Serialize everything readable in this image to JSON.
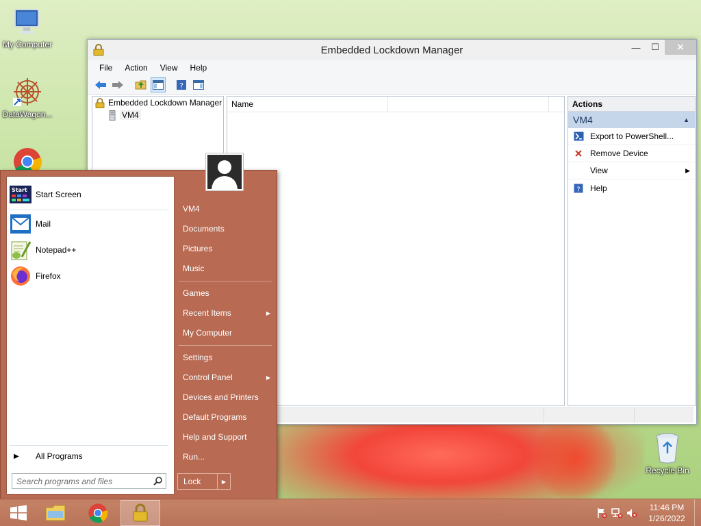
{
  "desktop": {
    "icons": [
      {
        "label": "My Computer"
      },
      {
        "label": "DataWagon..."
      },
      {
        "label": "Recycle Bin"
      }
    ]
  },
  "window": {
    "title": "Embedded Lockdown Manager",
    "min_glyph": "—",
    "max_glyph": "☐",
    "close_glyph": "✕",
    "menu": [
      "File",
      "Action",
      "View",
      "Help"
    ],
    "tree": {
      "root": "Embedded Lockdown Manager",
      "child": "VM4"
    },
    "list": {
      "columns": [
        "Name",
        ""
      ]
    },
    "actions": {
      "header": "Actions",
      "section": "VM4",
      "items": [
        {
          "label": "Export to PowerShell..."
        },
        {
          "label": "Remove Device"
        },
        {
          "label": "View"
        },
        {
          "label": "Help"
        }
      ]
    }
  },
  "start_menu": {
    "pinned": [
      {
        "label": "Start Screen"
      },
      {
        "label": "Mail"
      },
      {
        "label": "Notepad++"
      },
      {
        "label": "Firefox"
      }
    ],
    "start_tile_text": "Start",
    "all_programs": "All Programs",
    "search_placeholder": "Search programs and files",
    "right_links": {
      "user": "VM4",
      "documents": "Documents",
      "pictures": "Pictures",
      "music": "Music",
      "games": "Games",
      "recent_items": "Recent Items",
      "my_computer": "My Computer",
      "settings": "Settings",
      "control_panel": "Control Panel",
      "devices_printers": "Devices and Printers",
      "default_programs": "Default Programs",
      "help_support": "Help and Support",
      "run": "Run..."
    },
    "lock_label": "Lock"
  },
  "taskbar": {
    "time": "11:46 PM",
    "date": "1/26/2022"
  }
}
